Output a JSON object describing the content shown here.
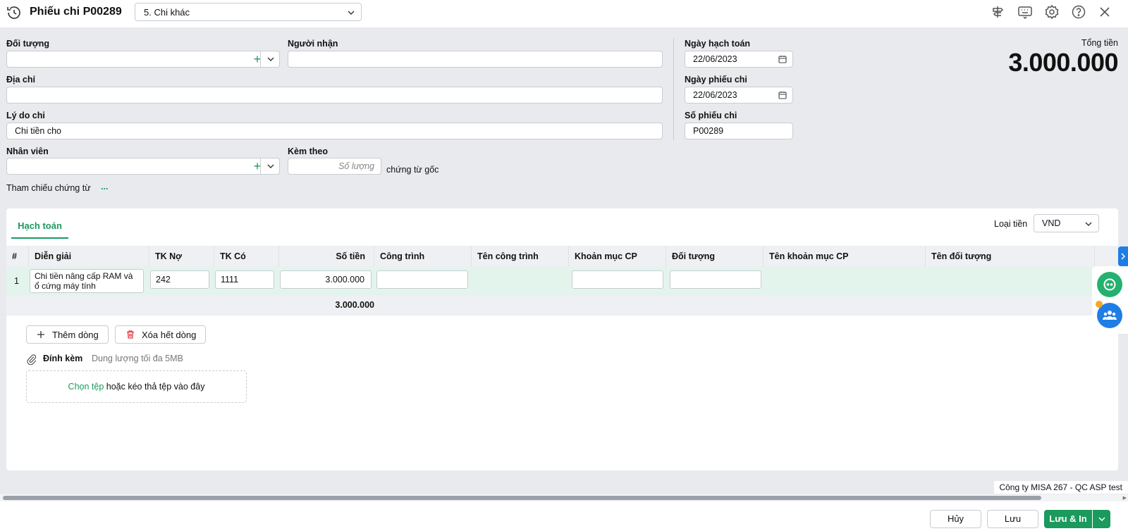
{
  "header": {
    "title": "Phiếu chi P00289",
    "type_value": "5. Chi khác",
    "icons": [
      "history-icon",
      "shortcut-icon",
      "keyboard-icon",
      "settings-icon",
      "help-icon",
      "close-icon"
    ]
  },
  "form": {
    "doi_tuong_label": "Đối tượng",
    "doi_tuong_value": "",
    "nguoi_nhan_label": "Người nhận",
    "nguoi_nhan_value": "",
    "dia_chi_label": "Địa chỉ",
    "dia_chi_value": "",
    "ly_do_label": "Lý do chi",
    "ly_do_value": "Chi tiền cho",
    "nhan_vien_label": "Nhân viên",
    "nhan_vien_value": "",
    "kem_theo_label": "Kèm theo",
    "kem_theo_placeholder": "Số lượng",
    "chung_tu_goc": "chứng từ gốc",
    "tham_chieu_label": "Tham chiếu chứng từ",
    "tham_chieu_more": "...",
    "ngay_hach_toan_label": "Ngày hạch toán",
    "ngay_hach_toan_value": "22/06/2023",
    "ngay_phieu_chi_label": "Ngày phiếu chi",
    "ngay_phieu_chi_value": "22/06/2023",
    "so_phieu_chi_label": "Số phiếu chi",
    "so_phieu_chi_value": "P00289",
    "tong_tien_label": "Tổng tiền",
    "tong_tien_value": "3.000.000"
  },
  "detail": {
    "tab_label": "Hạch toán",
    "currency_label": "Loại tiền",
    "currency_value": "VND",
    "columns": [
      "#",
      "Diễn giải",
      "TK Nợ",
      "TK Có",
      "Số tiền",
      "Công trình",
      "Tên công trình",
      "Khoản mục CP",
      "Đối tượng",
      "Tên khoản mục CP",
      "Tên đối tượng"
    ],
    "rows": [
      {
        "no": "1",
        "dien_giai": "Chi tiền nâng cấp RAM và ổ cứng máy tính",
        "tk_no": "242",
        "tk_co": "1111",
        "so_tien": "3.000.000"
      }
    ],
    "total": "3.000.000",
    "add_row_label": "Thêm dòng",
    "delete_rows_label": "Xóa hết dòng"
  },
  "attachment": {
    "label": "Đính kèm",
    "hint": "Dung lượng tối đa 5MB",
    "choose_link": "Chọn tệp",
    "drop_text": " hoặc kéo thả tệp vào đây"
  },
  "company": "Công ty MISA 267 - QC ASP test",
  "footer": {
    "cancel_label": "Hủy",
    "save_label": "Lưu",
    "save_print_label": "Lưu & In"
  },
  "colors": {
    "accent": "#1a9a5c",
    "blue": "#1f7de6",
    "background": "#e8eaee"
  }
}
